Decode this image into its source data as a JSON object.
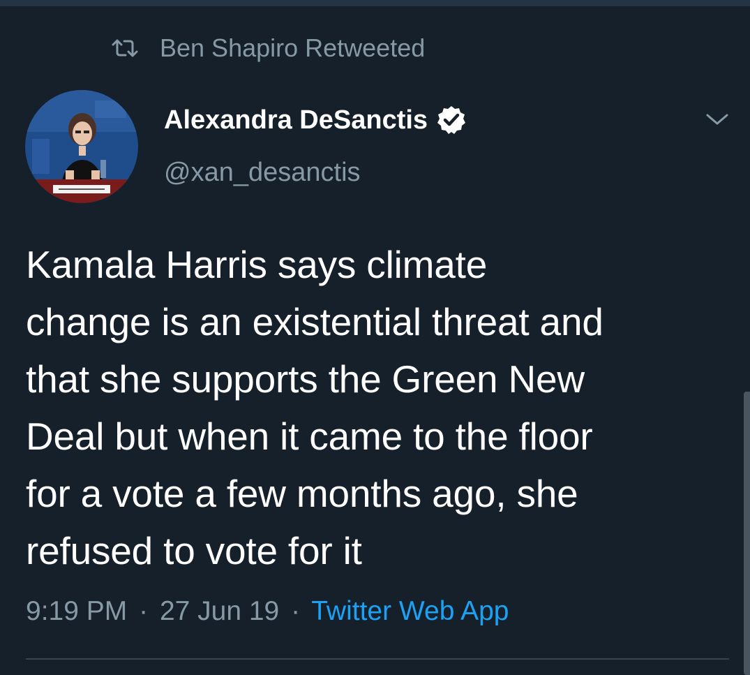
{
  "retweet": {
    "label": "Ben Shapiro Retweeted",
    "icon": "retweet-icon"
  },
  "author": {
    "name": "Alexandra DeSanctis",
    "handle": "@xan_desanctis",
    "verified": true,
    "avatar_caption": "Alexandra DeSanctis"
  },
  "tweet": {
    "text": "Kamala Harris says climate\nchange is an existential threat and\nthat she supports the Green New\nDeal but when it came to the floor\nfor a vote a few months ago, she\nrefused to vote for it"
  },
  "meta": {
    "time": "9:19 PM",
    "separator": "·",
    "date": "27 Jun 19",
    "source": "Twitter Web App"
  },
  "colors": {
    "background": "#15202b",
    "secondary_text": "#8899a6",
    "link": "#1da1f2",
    "verified_badge": "#ffffff"
  }
}
